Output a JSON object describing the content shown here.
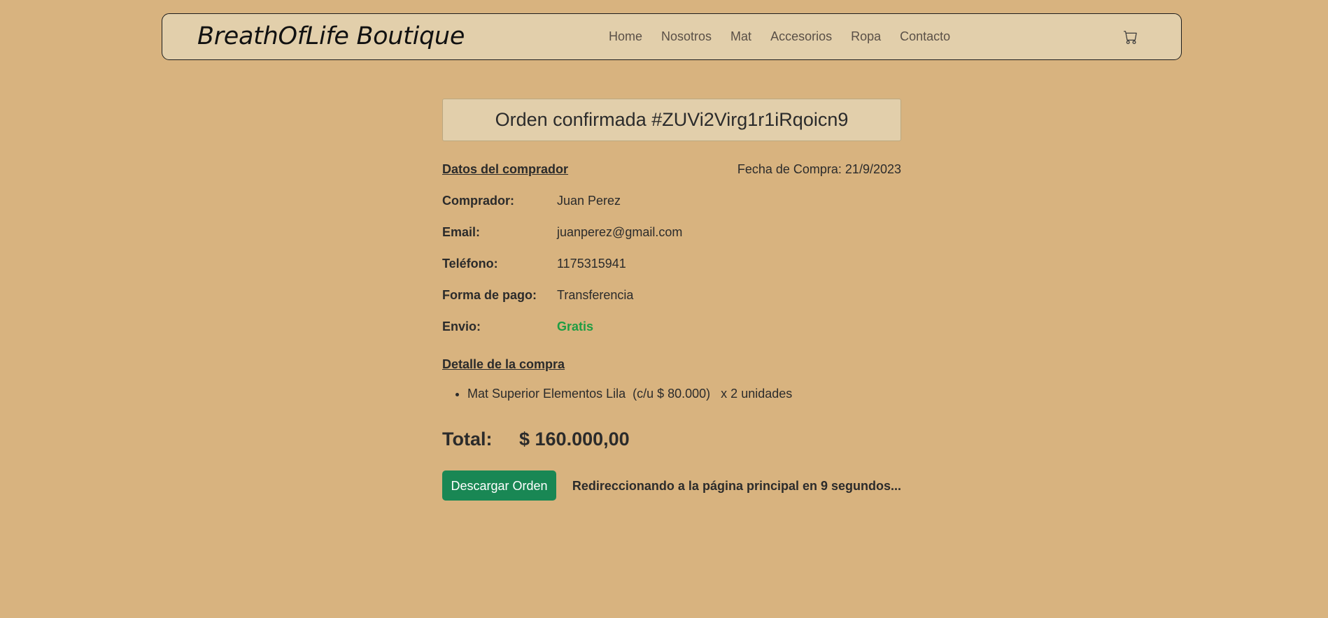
{
  "header": {
    "brand": "BreathOfLife Boutique",
    "nav": [
      "Home",
      "Nosotros",
      "Mat",
      "Accesorios",
      "Ropa",
      "Contacto"
    ],
    "cart_icon": "cart-icon"
  },
  "order": {
    "title": "Orden confirmada #ZUVi2Virg1r1iRqoicn9",
    "buyer_section": "Datos del comprador",
    "date": "Fecha de Compra: 21/9/2023",
    "fields": [
      {
        "label": "Comprador:",
        "value": "Juan Perez"
      },
      {
        "label": "Email:",
        "value": "juanperez@gmail.com"
      },
      {
        "label": "Teléfono:",
        "value": "1175315941"
      },
      {
        "label": "Forma de pago:",
        "value": "Transferencia"
      },
      {
        "label": "Envio:",
        "value": "Gratis"
      }
    ],
    "detail_section": "Detalle de la compra",
    "items": [
      "Mat Superior Elementos Lila  (c/u $ 80.000)   x 2 unidades"
    ],
    "total_label": "Total:",
    "total_value": "$ 160.000,00",
    "download_label": "Descargar Orden",
    "redirect_text": "Redireccionando a la página principal en 9 segundos..."
  },
  "colors": {
    "background": "#d8b37f",
    "navbar": "#e2cfab",
    "button": "#198754",
    "free_shipping": "#1f9d43"
  }
}
